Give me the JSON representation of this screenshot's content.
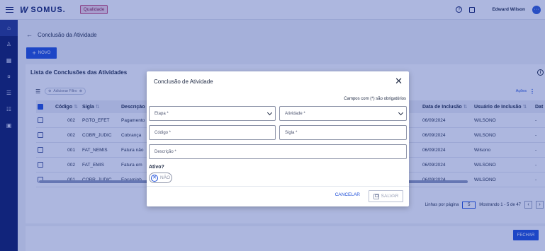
{
  "topbar": {
    "logo_mark": "W",
    "logo_text": "SOMUS.",
    "env_badge": "Qualidade",
    "help_icon": "question-circle-icon",
    "news_icon": "news-icon",
    "user_name": "Edward Wilson",
    "avatar_text": "···"
  },
  "sidebar": {
    "items": [
      {
        "icon": "home-icon",
        "glyph": "⌂"
      },
      {
        "icon": "people-icon",
        "glyph": "♙"
      },
      {
        "icon": "table-icon",
        "glyph": "▦"
      },
      {
        "icon": "money-icon",
        "glyph": "¤"
      },
      {
        "icon": "list-icon",
        "glyph": "☰"
      },
      {
        "icon": "list-check-icon",
        "glyph": "☷"
      },
      {
        "icon": "grid-icon",
        "glyph": "▣"
      }
    ]
  },
  "page": {
    "title": "Conclusão da Atividade",
    "new_button": "NOVO"
  },
  "list": {
    "title": "Lista de Conclusões das Atividades",
    "filter_chip": "Adicionar Filtro",
    "actions_label": "Ações",
    "columns": [
      "Código",
      "Sigla",
      "Descrição",
      "Data de Inclusão",
      "Usuário de Inclusão",
      "Dat"
    ],
    "rows": [
      {
        "codigo": "002",
        "sigla": "PGTO_EFET",
        "descricao": "Pagamento",
        "data": "06/09/2024",
        "usuario": "WILSONO",
        "dat": "-"
      },
      {
        "codigo": "002",
        "sigla": "COBR_JUDIC",
        "descricao": "Cobrança",
        "data": "06/09/2024",
        "usuario": "WILSONO",
        "dat": "-"
      },
      {
        "codigo": "001",
        "sigla": "FAT_NEMIS",
        "descricao": "Fatura não",
        "data": "06/09/2024",
        "usuario": "Wilsono",
        "dat": "-"
      },
      {
        "codigo": "002",
        "sigla": "FAT_EMIS",
        "descricao": "Fatura em",
        "data": "06/09/2024",
        "usuario": "WILSONO",
        "dat": "-"
      },
      {
        "codigo": "001",
        "sigla": "COBR_JUDIC",
        "descricao": "Encaminh",
        "data": "06/09/2024",
        "usuario": "WILSONO",
        "dat": "-"
      }
    ],
    "pager": {
      "rows_label": "Linhas por página",
      "page_size": "5",
      "showing": "Mostrando 1 - 5 de 47",
      "prev": "‹",
      "next": "›"
    }
  },
  "footer": {
    "close_button": "FECHAR"
  },
  "modal": {
    "title": "Conclusão de Atividade",
    "close": "✕",
    "required_note": "Campos com (*) são obrigatórios",
    "etapa_label": "Etapa *",
    "atividade_label": "Atividade *",
    "codigo_label": "Código *",
    "sigla_label": "Sigla *",
    "descricao_label": "Descrição *",
    "ativo_label": "Ativo?",
    "toggle_icon": "✕",
    "toggle_text": "NÃO",
    "cancel_button": "CANCELAR",
    "save_button": "SALVAR"
  }
}
